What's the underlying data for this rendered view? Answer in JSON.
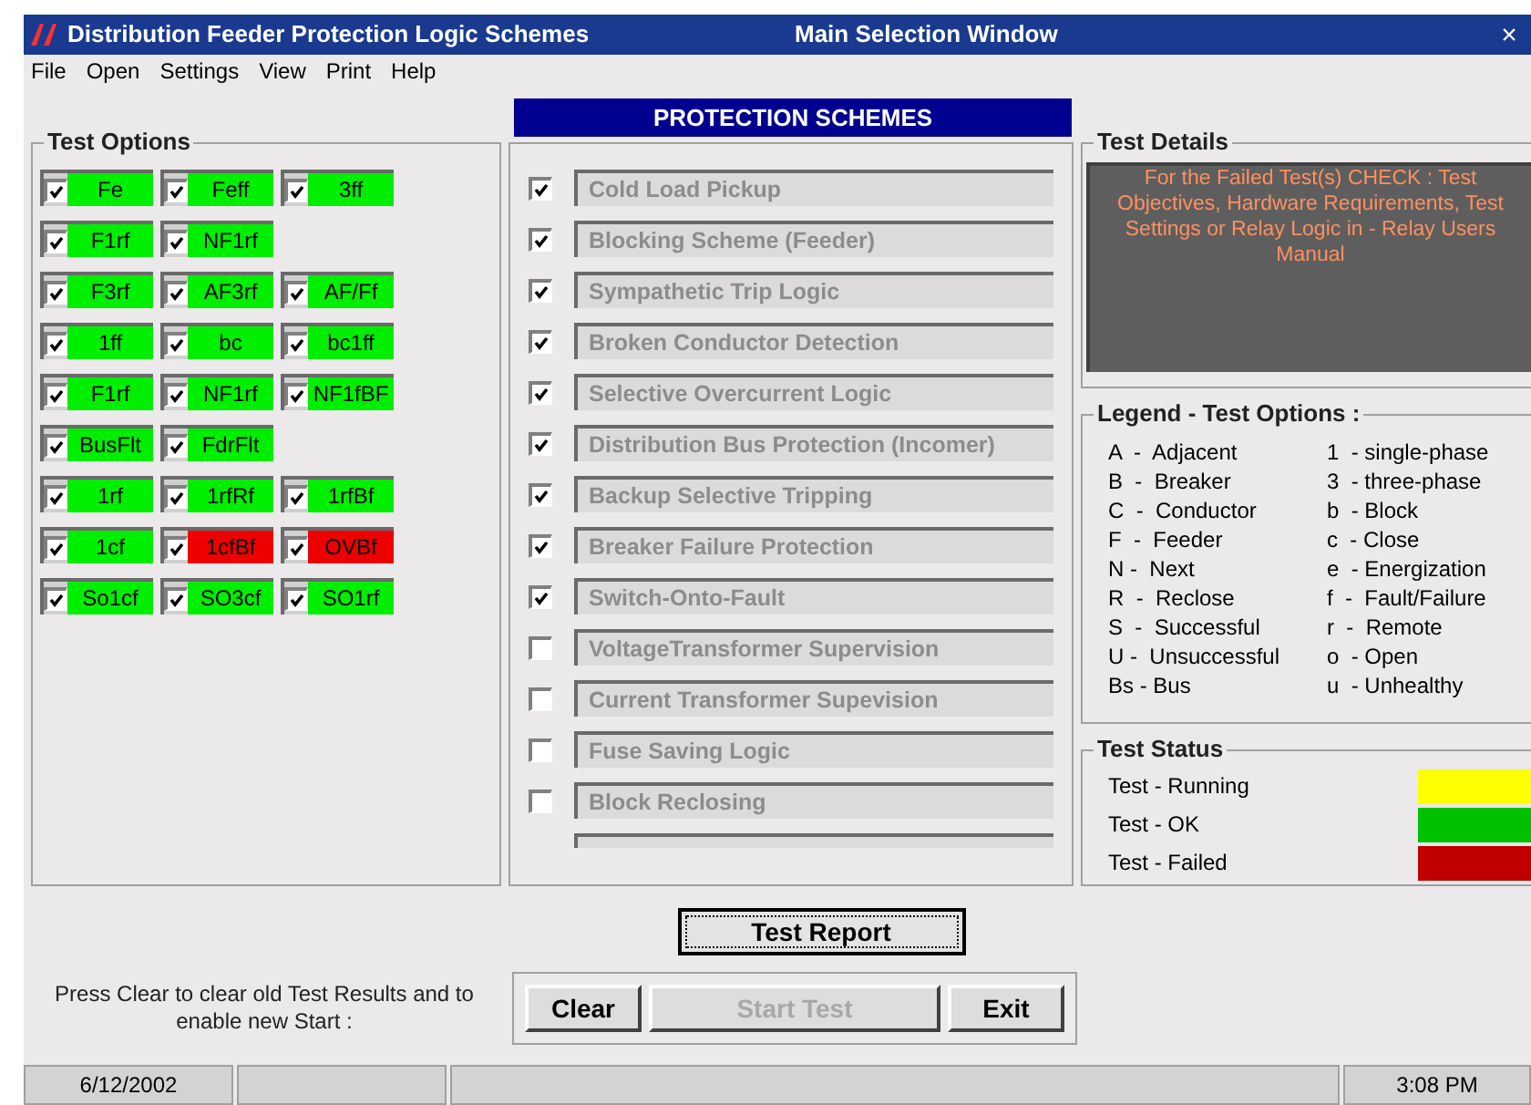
{
  "window": {
    "title": "Distribution Feeder Protection Logic Schemes",
    "subtitle": "Main Selection Window",
    "close": "×"
  },
  "menu": [
    "File",
    "Open",
    "Settings",
    "View",
    "Print",
    "Help"
  ],
  "test_options": {
    "title": "Test Options",
    "rows": [
      [
        {
          "label": "Fe",
          "checked": true,
          "color": "#00ee00"
        },
        {
          "label": "Feff",
          "checked": true,
          "color": "#00ee00"
        },
        {
          "label": "3ff",
          "checked": true,
          "color": "#00ee00"
        }
      ],
      [
        {
          "label": "F1rf",
          "checked": true,
          "color": "#00ee00"
        },
        {
          "label": "NF1rf",
          "checked": true,
          "color": "#00ee00"
        }
      ],
      [
        {
          "label": "F3rf",
          "checked": true,
          "color": "#00ee00"
        },
        {
          "label": "AF3rf",
          "checked": true,
          "color": "#00ee00"
        },
        {
          "label": "AF/Ff",
          "checked": true,
          "color": "#00ee00"
        }
      ],
      [
        {
          "label": "1ff",
          "checked": true,
          "color": "#00ee00"
        },
        {
          "label": "bc",
          "checked": true,
          "color": "#00ee00"
        },
        {
          "label": "bc1ff",
          "checked": true,
          "color": "#00ee00"
        }
      ],
      [
        {
          "label": "F1rf",
          "checked": true,
          "color": "#00ee00"
        },
        {
          "label": "NF1rf",
          "checked": true,
          "color": "#00ee00"
        },
        {
          "label": "NF1fBF",
          "checked": true,
          "color": "#00ee00"
        }
      ],
      [
        {
          "label": "BusFlt",
          "checked": true,
          "color": "#00ee00"
        },
        {
          "label": "FdrFlt",
          "checked": true,
          "color": "#00ee00"
        }
      ],
      [
        {
          "label": "1rf",
          "checked": true,
          "color": "#00ee00"
        },
        {
          "label": "1rfRf",
          "checked": true,
          "color": "#00ee00"
        },
        {
          "label": "1rfBf",
          "checked": true,
          "color": "#00ee00"
        }
      ],
      [
        {
          "label": "1cf",
          "checked": true,
          "color": "#00ee00"
        },
        {
          "label": "1cfBf",
          "checked": true,
          "color": "#ee0000"
        },
        {
          "label": "OVBf",
          "checked": true,
          "color": "#ee0000"
        }
      ],
      [
        {
          "label": "So1cf",
          "checked": true,
          "color": "#00ee00"
        },
        {
          "label": "SO3cf",
          "checked": true,
          "color": "#00ee00"
        },
        {
          "label": "SO1rf",
          "checked": true,
          "color": "#00ee00"
        }
      ]
    ]
  },
  "protection_schemes": {
    "title": "PROTECTION SCHEMES",
    "items": [
      {
        "label": "Cold Load Pickup",
        "checked": true
      },
      {
        "label": "Blocking Scheme (Feeder)",
        "checked": true
      },
      {
        "label": "Sympathetic Trip Logic",
        "checked": true
      },
      {
        "label": "Broken Conductor Detection",
        "checked": true
      },
      {
        "label": "Selective Overcurrent Logic",
        "checked": true
      },
      {
        "label": "Distribution Bus Protection (Incomer)",
        "checked": true
      },
      {
        "label": "Backup Selective Tripping",
        "checked": true
      },
      {
        "label": "Breaker Failure Protection",
        "checked": true
      },
      {
        "label": "Switch-Onto-Fault",
        "checked": true
      },
      {
        "label": "VoltageTransformer Supervision",
        "checked": false
      },
      {
        "label": "Current Transformer Supevision",
        "checked": false
      },
      {
        "label": "Fuse Saving Logic",
        "checked": false
      },
      {
        "label": "Block Reclosing",
        "checked": false
      }
    ]
  },
  "test_details": {
    "title": "Test Details",
    "text": "For the Failed Test(s)  CHECK :  Test Objectives, Hardware Requirements, Test Settings or Relay Logic in  - Relay Users Manual"
  },
  "legend": {
    "title": "Legend - Test Options :",
    "rows": [
      [
        "A  -  Adjacent",
        "1  - single-phase"
      ],
      [
        "B  -  Breaker",
        "3  - three-phase"
      ],
      [
        "C  -  Conductor",
        "b  - Block"
      ],
      [
        "F  -  Feeder",
        "c  - Close"
      ],
      [
        "N -  Next",
        "e  - Energization"
      ],
      [
        "R  -  Reclose",
        "f  -  Fault/Failure"
      ],
      [
        "S  -  Successful",
        "r  -  Remote"
      ],
      [
        "U -  Unsuccessful",
        "o  - Open"
      ],
      [
        "Bs - Bus",
        "u  - Unhealthy"
      ]
    ]
  },
  "test_status": {
    "title": "Test Status",
    "items": [
      {
        "label": "Test - Running",
        "color": "#ffff00"
      },
      {
        "label": "Test - OK",
        "color": "#00c000"
      },
      {
        "label": "Test - Failed",
        "color": "#c00000"
      }
    ]
  },
  "test_report_button": "Test Report",
  "hint": "Press  Clear  to clear old Test Results and to enable new Start :",
  "buttons": [
    {
      "label": "Clear",
      "disabled": false
    },
    {
      "label": "Start Test",
      "disabled": true
    },
    {
      "label": "Exit",
      "disabled": false
    }
  ],
  "status_bar": {
    "date": "6/12/2002",
    "time": "3:08 PM"
  }
}
